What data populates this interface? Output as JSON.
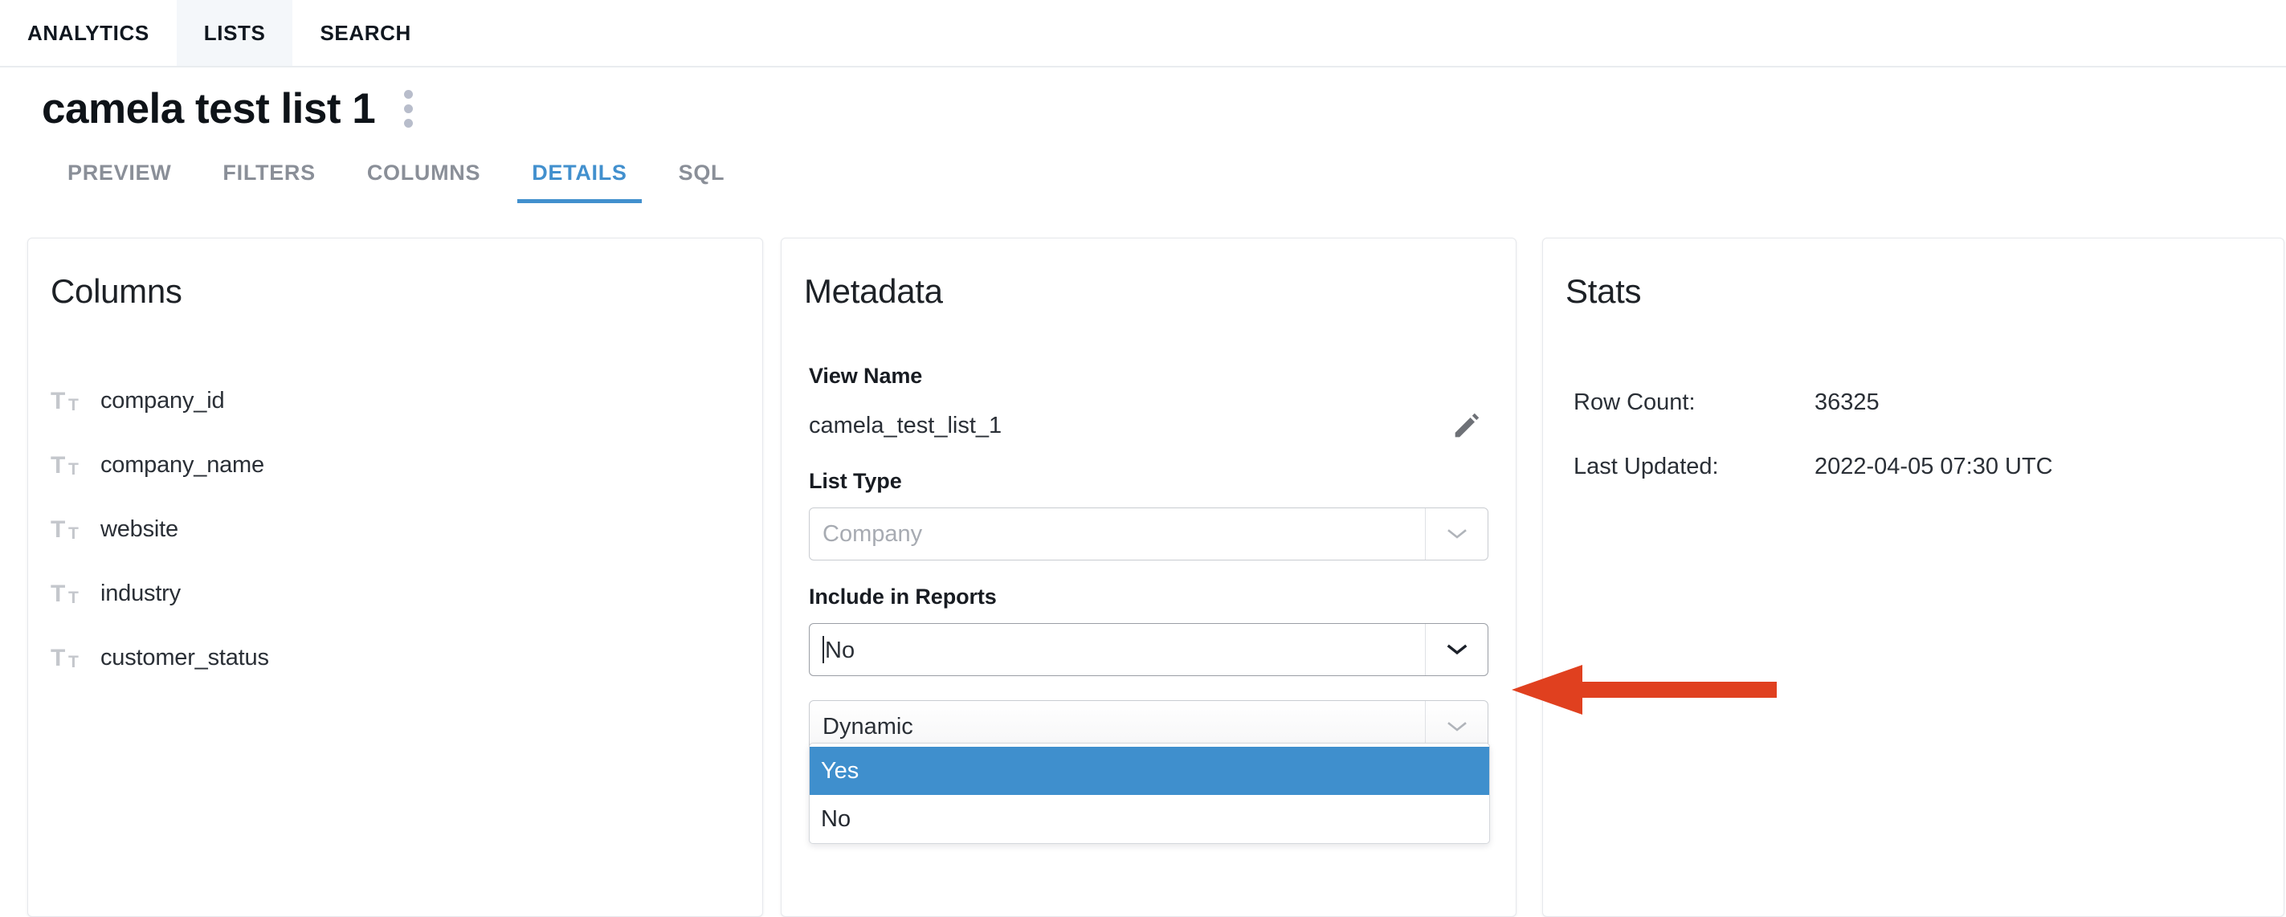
{
  "topnav": {
    "items": [
      {
        "label": "ANALYTICS",
        "active": false
      },
      {
        "label": "LISTS",
        "active": true
      },
      {
        "label": "SEARCH",
        "active": false
      }
    ]
  },
  "header": {
    "title": "camela test list 1",
    "menu_icon": "kebab-menu-icon"
  },
  "subtabs": {
    "items": [
      {
        "label": "PREVIEW"
      },
      {
        "label": "FILTERS"
      },
      {
        "label": "COLUMNS"
      },
      {
        "label": "DETAILS"
      },
      {
        "label": "SQL"
      }
    ],
    "active": "DETAILS",
    "accent_color": "#4290ce"
  },
  "columns_card": {
    "title": "Columns",
    "items": [
      {
        "icon": "text-type-icon",
        "label": "company_id"
      },
      {
        "icon": "text-type-icon",
        "label": "company_name"
      },
      {
        "icon": "text-type-icon",
        "label": "website"
      },
      {
        "icon": "text-type-icon",
        "label": "industry"
      },
      {
        "icon": "text-type-icon",
        "label": "customer_status"
      }
    ]
  },
  "metadata_card": {
    "title": "Metadata",
    "view_name_label": "View Name",
    "view_name_value": "camela_test_list_1",
    "edit_icon": "pencil-icon",
    "list_type_label": "List Type",
    "list_type_value": "Company",
    "include_in_reports_label": "Include in Reports",
    "include_in_reports_value": "No",
    "include_in_reports_options": [
      {
        "label": "Yes",
        "selected": true
      },
      {
        "label": "No",
        "selected": false
      }
    ],
    "refresh_type_value": "Dynamic",
    "highlight_color": "#3f8fcd"
  },
  "stats_card": {
    "title": "Stats",
    "rows": [
      {
        "label": "Row Count:",
        "value": "36325"
      },
      {
        "label": "Last Updated:",
        "value": "2022-04-05 07:30 UTC"
      }
    ]
  },
  "annotation": {
    "arrow_icon": "left-arrow-annotation",
    "color": "#e0401f"
  }
}
